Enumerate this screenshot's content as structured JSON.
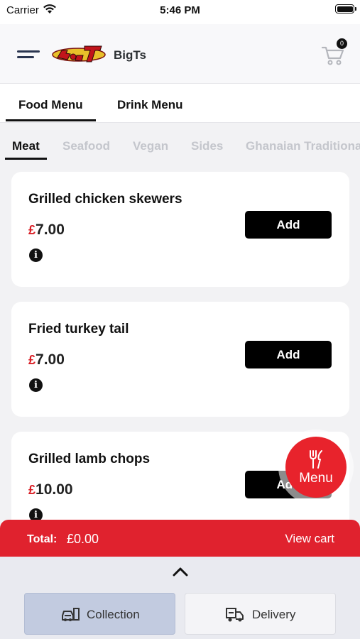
{
  "status_bar": {
    "carrier": "Carrier",
    "time": "5:46 PM"
  },
  "header": {
    "brand": "BigTs",
    "logo_icon": "bigts-logo",
    "cart_count": "0"
  },
  "main_tabs": [
    {
      "label": "Food Menu",
      "active": true
    },
    {
      "label": "Drink Menu",
      "active": false
    }
  ],
  "category_tabs": [
    {
      "label": "Meat",
      "active": true
    },
    {
      "label": "Seafood",
      "active": false
    },
    {
      "label": "Vegan",
      "active": false
    },
    {
      "label": "Sides",
      "active": false
    },
    {
      "label": "Ghanaian Traditional",
      "active": false
    }
  ],
  "items": [
    {
      "name": "Grilled chicken skewers",
      "currency": "£",
      "price": "7.00",
      "add_label": "Add"
    },
    {
      "name": "Fried turkey tail",
      "currency": "£",
      "price": "7.00",
      "add_label": "Add"
    },
    {
      "name": "Grilled lamb chops",
      "currency": "£",
      "price": "10.00",
      "add_label": "Add"
    }
  ],
  "fab": {
    "label": "Menu",
    "icon": "fork-knife-icon"
  },
  "total_bar": {
    "label": "Total:",
    "value": "£0.00",
    "view_cart": "View cart"
  },
  "order_modes": [
    {
      "label": "Collection",
      "icon": "collection-car-icon",
      "selected": true
    },
    {
      "label": "Delivery",
      "icon": "delivery-truck-icon",
      "selected": false
    }
  ],
  "colors": {
    "accent": "#e0222e",
    "price_currency": "#d91f26",
    "button": "#000000",
    "selected_mode": "#c2cbe0"
  }
}
